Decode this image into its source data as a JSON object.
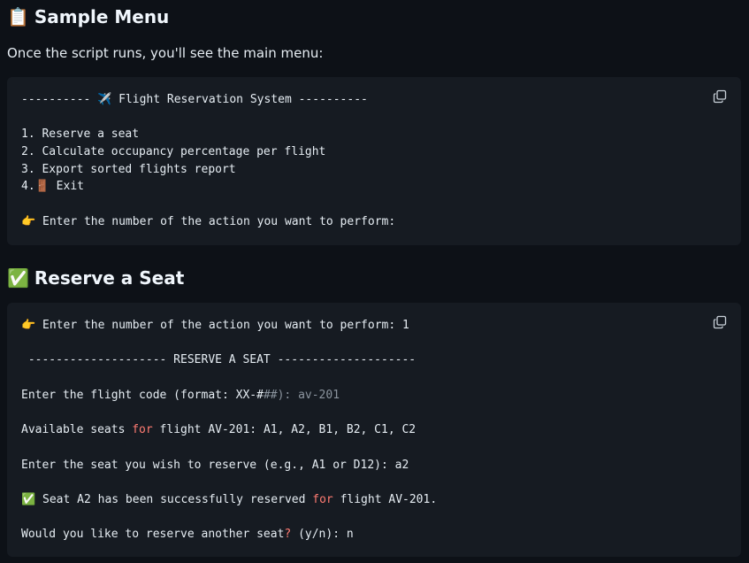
{
  "section1": {
    "emoji": "📋",
    "title": "Sample Menu",
    "intro": "Once the script runs, you'll see the main menu:",
    "code": {
      "header_prefix": "---------- ",
      "header_emoji": "✈️",
      "header_text": " Flight Reservation System ----------",
      "item1": "1. Reserve a seat",
      "item2": "2. Calculate occupancy percentage per flight",
      "item3": "3. Export sorted flights report",
      "item4_prefix": "4.",
      "item4_emoji": "🚪",
      "item4_text": " Exit",
      "prompt_emoji": "👉",
      "prompt_text": " Enter the number of the action you want to perform:"
    }
  },
  "section2": {
    "emoji": "✅",
    "title": "Reserve a Seat",
    "code": {
      "prompt_emoji": "👉",
      "prompt_text": " Enter the number of the action you want to perform: 1",
      "banner": " -------------------- RESERVE A SEAT --------------------",
      "flight_prompt": "Enter the flight code (format: XX-#",
      "flight_prompt_muted": "##): av-201",
      "avail_a": "Available seats ",
      "avail_kw": "for",
      "avail_b": " flight AV-201: A1, A2, B1, B2, C1, C2",
      "seat_prompt": "Enter the seat you wish to reserve (e.g., A1 or D12): a2",
      "success_emoji": "✅",
      "success_a": " Seat A2 has been successfully reserved ",
      "success_kw": "for",
      "success_b": " flight AV-201.",
      "again_a": "Would you like to reserve another seat",
      "again_kw": "?",
      "again_b": " (y/n): n"
    }
  },
  "icons": {
    "copy": "copy-icon"
  }
}
